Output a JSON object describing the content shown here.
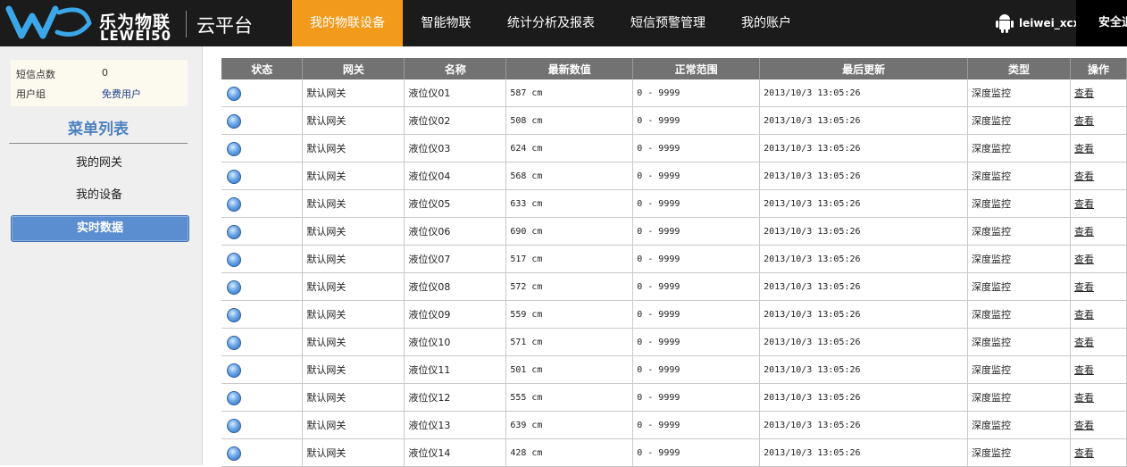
{
  "brand": {
    "name_cn": "乐为物联",
    "name_en": "LEWEI50",
    "platform": "云平台",
    "accent": "#f29a1b"
  },
  "nav": {
    "items": [
      {
        "label": "我的物联设备",
        "active": true
      },
      {
        "label": "智能物联",
        "active": false
      },
      {
        "label": "统计分析及报表",
        "active": false
      },
      {
        "label": "短信预警管理",
        "active": false
      },
      {
        "label": "我的账户",
        "active": false
      }
    ]
  },
  "user": {
    "icon": "android-icon",
    "name": "leiwei_xcx",
    "safe_label": "安全退出"
  },
  "sidebar": {
    "sms_label": "短信点数",
    "sms_value": "0",
    "group_label": "用户组",
    "group_value": "免费用户",
    "menu_title": "菜单列表",
    "menu": [
      {
        "label": "我的网关",
        "active": false
      },
      {
        "label": "我的设备",
        "active": false
      },
      {
        "label": "实时数据",
        "active": true
      }
    ]
  },
  "table": {
    "headers": [
      "状态",
      "网关",
      "名称",
      "最新数值",
      "正常范围",
      "最后更新",
      "类型",
      "操作"
    ],
    "rows": [
      {
        "gateway": "默认网关",
        "name": "液位仪01",
        "value": "587 cm",
        "range": "0 - 9999",
        "updated": "2013/10/3 13:05:26",
        "type": "深度监控",
        "action": "查看"
      },
      {
        "gateway": "默认网关",
        "name": "液位仪02",
        "value": "508 cm",
        "range": "0 - 9999",
        "updated": "2013/10/3 13:05:26",
        "type": "深度监控",
        "action": "查看"
      },
      {
        "gateway": "默认网关",
        "name": "液位仪03",
        "value": "624 cm",
        "range": "0 - 9999",
        "updated": "2013/10/3 13:05:26",
        "type": "深度监控",
        "action": "查看"
      },
      {
        "gateway": "默认网关",
        "name": "液位仪04",
        "value": "568 cm",
        "range": "0 - 9999",
        "updated": "2013/10/3 13:05:26",
        "type": "深度监控",
        "action": "查看"
      },
      {
        "gateway": "默认网关",
        "name": "液位仪05",
        "value": "633 cm",
        "range": "0 - 9999",
        "updated": "2013/10/3 13:05:26",
        "type": "深度监控",
        "action": "查看"
      },
      {
        "gateway": "默认网关",
        "name": "液位仪06",
        "value": "690 cm",
        "range": "0 - 9999",
        "updated": "2013/10/3 13:05:26",
        "type": "深度监控",
        "action": "查看"
      },
      {
        "gateway": "默认网关",
        "name": "液位仪07",
        "value": "517 cm",
        "range": "0 - 9999",
        "updated": "2013/10/3 13:05:26",
        "type": "深度监控",
        "action": "查看"
      },
      {
        "gateway": "默认网关",
        "name": "液位仪08",
        "value": "572 cm",
        "range": "0 - 9999",
        "updated": "2013/10/3 13:05:26",
        "type": "深度监控",
        "action": "查看"
      },
      {
        "gateway": "默认网关",
        "name": "液位仪09",
        "value": "559 cm",
        "range": "0 - 9999",
        "updated": "2013/10/3 13:05:26",
        "type": "深度监控",
        "action": "查看"
      },
      {
        "gateway": "默认网关",
        "name": "液位仪10",
        "value": "571 cm",
        "range": "0 - 9999",
        "updated": "2013/10/3 13:05:26",
        "type": "深度监控",
        "action": "查看"
      },
      {
        "gateway": "默认网关",
        "name": "液位仪11",
        "value": "501 cm",
        "range": "0 - 9999",
        "updated": "2013/10/3 13:05:26",
        "type": "深度监控",
        "action": "查看"
      },
      {
        "gateway": "默认网关",
        "name": "液位仪12",
        "value": "555 cm",
        "range": "0 - 9999",
        "updated": "2013/10/3 13:05:26",
        "type": "深度监控",
        "action": "查看"
      },
      {
        "gateway": "默认网关",
        "name": "液位仪13",
        "value": "639 cm",
        "range": "0 - 9999",
        "updated": "2013/10/3 13:05:26",
        "type": "深度监控",
        "action": "查看"
      },
      {
        "gateway": "默认网关",
        "name": "液位仪14",
        "value": "428 cm",
        "range": "0 - 9999",
        "updated": "2013/10/3 13:05:26",
        "type": "深度监控",
        "action": "查看"
      }
    ]
  }
}
